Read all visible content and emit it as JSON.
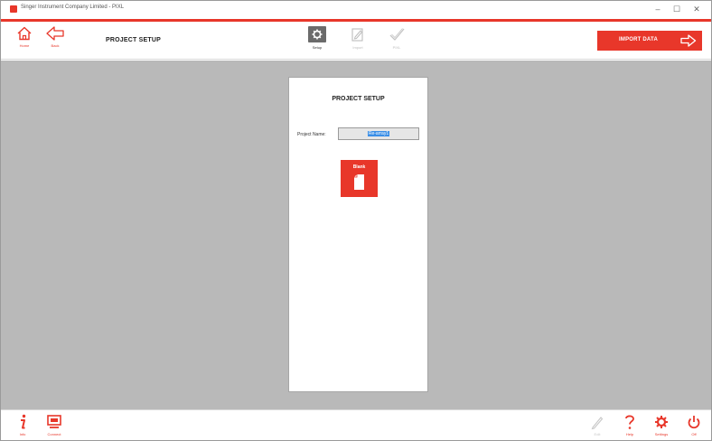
{
  "window": {
    "title": "Singer Instrument Company Limited - PIXL",
    "minimize": "–",
    "maximize": "☐",
    "close": "✕"
  },
  "toolbar": {
    "home_label": "Home",
    "back_label": "Back",
    "page_title": "PROJECT SETUP",
    "steps": [
      {
        "label": "Setup",
        "state": "active"
      },
      {
        "label": "Import",
        "state": "inactive"
      },
      {
        "label": "PIXL",
        "state": "inactive"
      }
    ],
    "import_button": "IMPORT DATA"
  },
  "panel": {
    "title": "PROJECT SETUP",
    "project_name_label": "Project Name:",
    "project_name_value": "Re-array1",
    "template_tile_label": "Blank"
  },
  "bottombar": {
    "info_label": "Info",
    "connect_label": "Connect",
    "edit_label": "Edit",
    "help_label": "Help",
    "settings_label": "Settings",
    "off_label": "Off"
  },
  "colors": {
    "accent": "#e8372a",
    "workspace": "#b9b9b9",
    "selection": "#3a8ee6",
    "step_active": "#6b6b6b",
    "disabled": "#c8c8c8"
  },
  "icons": {
    "home": "home-icon",
    "back": "back-arrow-icon",
    "setup": "gear-icon",
    "import": "edit-document-icon",
    "pixl": "checkmark-icon",
    "import_arrow": "forward-arrow-icon",
    "tile": "blank-document-icon",
    "info": "info-icon",
    "connect": "monitor-icon",
    "edit": "pencil-icon",
    "help": "question-icon",
    "settings": "gear-icon",
    "off": "power-icon"
  }
}
